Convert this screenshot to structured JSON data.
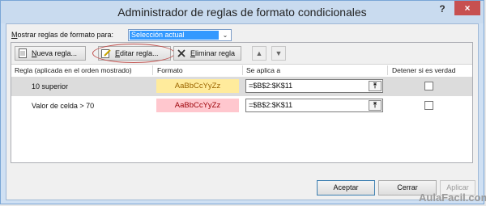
{
  "window": {
    "title": "Administrador de reglas de formato condicionales",
    "help_glyph": "?",
    "close_glyph": "×"
  },
  "show_rules": {
    "label_prefix": "M",
    "label_rest": "ostrar reglas de formato para:",
    "selected_value": "Selección actual"
  },
  "toolbar": {
    "new_rule_prefix": "N",
    "new_rule_rest": "ueva regla...",
    "edit_rule_prefix": "E",
    "edit_rule_rest": "ditar regla...",
    "delete_rule_prefix": "E",
    "delete_rule_rest": "liminar regla",
    "move_up_glyph": "▲",
    "move_down_glyph": "▼"
  },
  "columns": {
    "rule": "Regla (aplicada en el orden mostrado)",
    "format": "Formato",
    "applies_to": "Se aplica a",
    "stop_if_true": "Detener si es verdad"
  },
  "rules": [
    {
      "name": "10 superior",
      "format_preview": "AaBbCcYyZz",
      "preview_bg": "#ffeb9c",
      "preview_fg": "#9c6500",
      "applies_to": "=$B$2:$K$11",
      "stop_if_true": false,
      "selected": true
    },
    {
      "name": "Valor de celda > 70",
      "format_preview": "AaBbCcYyZz",
      "preview_bg": "#ffc7ce",
      "preview_fg": "#9c0006",
      "applies_to": "=$B$2:$K$11",
      "stop_if_true": false,
      "selected": false
    }
  ],
  "range_button_glyph": "⤒",
  "buttons": {
    "accept": "Aceptar",
    "cancel": "Cerrar",
    "apply": "Aplicar"
  },
  "watermark": "AulaFacil.com"
}
